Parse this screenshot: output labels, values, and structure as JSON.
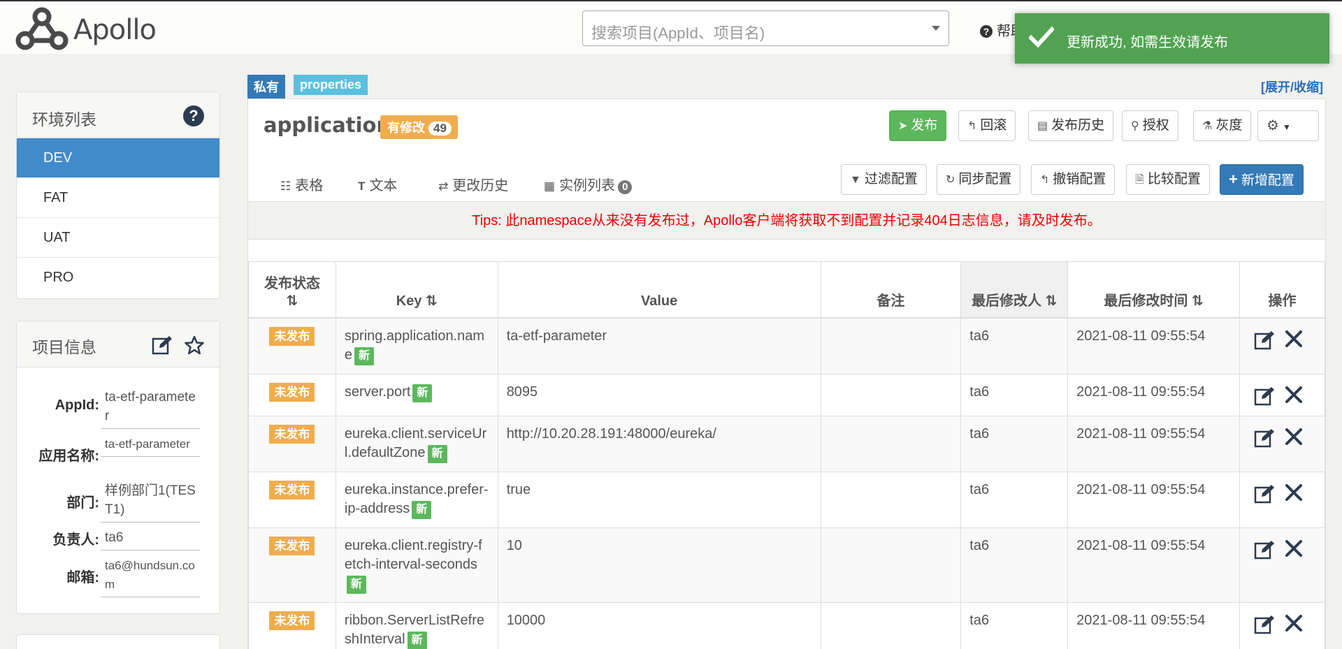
{
  "header": {
    "logo_text": "Apollo",
    "search_placeholder": "搜索项目(AppId、项目名)",
    "help_label": "帮助"
  },
  "toast": {
    "message": "更新成功, 如需生效请发布"
  },
  "env_panel": {
    "title": "环境列表",
    "items": [
      {
        "label": "DEV",
        "active": true
      },
      {
        "label": "FAT"
      },
      {
        "label": "UAT"
      },
      {
        "label": "PRO"
      }
    ]
  },
  "project_info": {
    "title": "项目信息",
    "rows": [
      {
        "label": "AppId:",
        "value": "ta-etf-parameter"
      },
      {
        "label": "应用名称:",
        "value": "ta-etf-parameter"
      },
      {
        "label": "部门:",
        "value": "样例部门1(TEST1)"
      },
      {
        "label": "负责人:",
        "value": "ta6"
      },
      {
        "label": "邮箱:",
        "value": "ta6@hundsun.com"
      }
    ]
  },
  "namespace": {
    "scope_badge": "私有",
    "format_badge": "properties",
    "toggle_link": "[展开/收缩]",
    "name": "application",
    "modified_label": "有修改",
    "modified_count": "49",
    "actions": {
      "publish": "发布",
      "rollback": "回滚",
      "history": "发布历史",
      "authorize": "授权",
      "gray": "灰度"
    },
    "tabs": {
      "table": "表格",
      "text": "文本",
      "change_history": "更改历史",
      "instances": "实例列表",
      "instances_count": "0"
    },
    "tools": {
      "filter": "过滤配置",
      "sync": "同步配置",
      "revoke": "撤销配置",
      "compare": "比较配置",
      "add": "新增配置"
    },
    "tips": "Tips: 此namespace从来没有发布过，Apollo客户端将获取不到配置并记录404日志信息，请及时发布。",
    "columns": {
      "status": "发布状态",
      "key": "Key",
      "value": "Value",
      "comment": "备注",
      "modifier": "最后修改人",
      "modified_time": "最后修改时间",
      "ops": "操作"
    },
    "status_label": "未发布",
    "new_label": "新",
    "rows": [
      {
        "key": "spring.application.name",
        "value": "ta-etf-parameter",
        "comment": "",
        "modifier": "ta6",
        "time": "2021-08-11 09:55:54"
      },
      {
        "key": "server.port",
        "value": "8095",
        "comment": "",
        "modifier": "ta6",
        "time": "2021-08-11 09:55:54"
      },
      {
        "key": "eureka.client.serviceUrl.defaultZone",
        "value": "http://10.20.28.191:48000/eureka/",
        "comment": "",
        "modifier": "ta6",
        "time": "2021-08-11 09:55:54"
      },
      {
        "key": "eureka.instance.prefer-ip-address",
        "value": "true",
        "comment": "",
        "modifier": "ta6",
        "time": "2021-08-11 09:55:54"
      },
      {
        "key": "eureka.client.registry-fetch-interval-seconds",
        "value": "10",
        "comment": "",
        "modifier": "ta6",
        "time": "2021-08-11 09:55:54"
      },
      {
        "key": "ribbon.ServerListRefreshInterval",
        "value": "10000",
        "comment": "",
        "modifier": "ta6",
        "time": "2021-08-11 09:55:54"
      }
    ]
  },
  "colors": {
    "primary": "#337ab7",
    "success": "#5cb85c",
    "warning": "#f0ad4e",
    "info": "#5bc0de",
    "env_active": "#428bca",
    "tips_text": "#ee0000"
  }
}
